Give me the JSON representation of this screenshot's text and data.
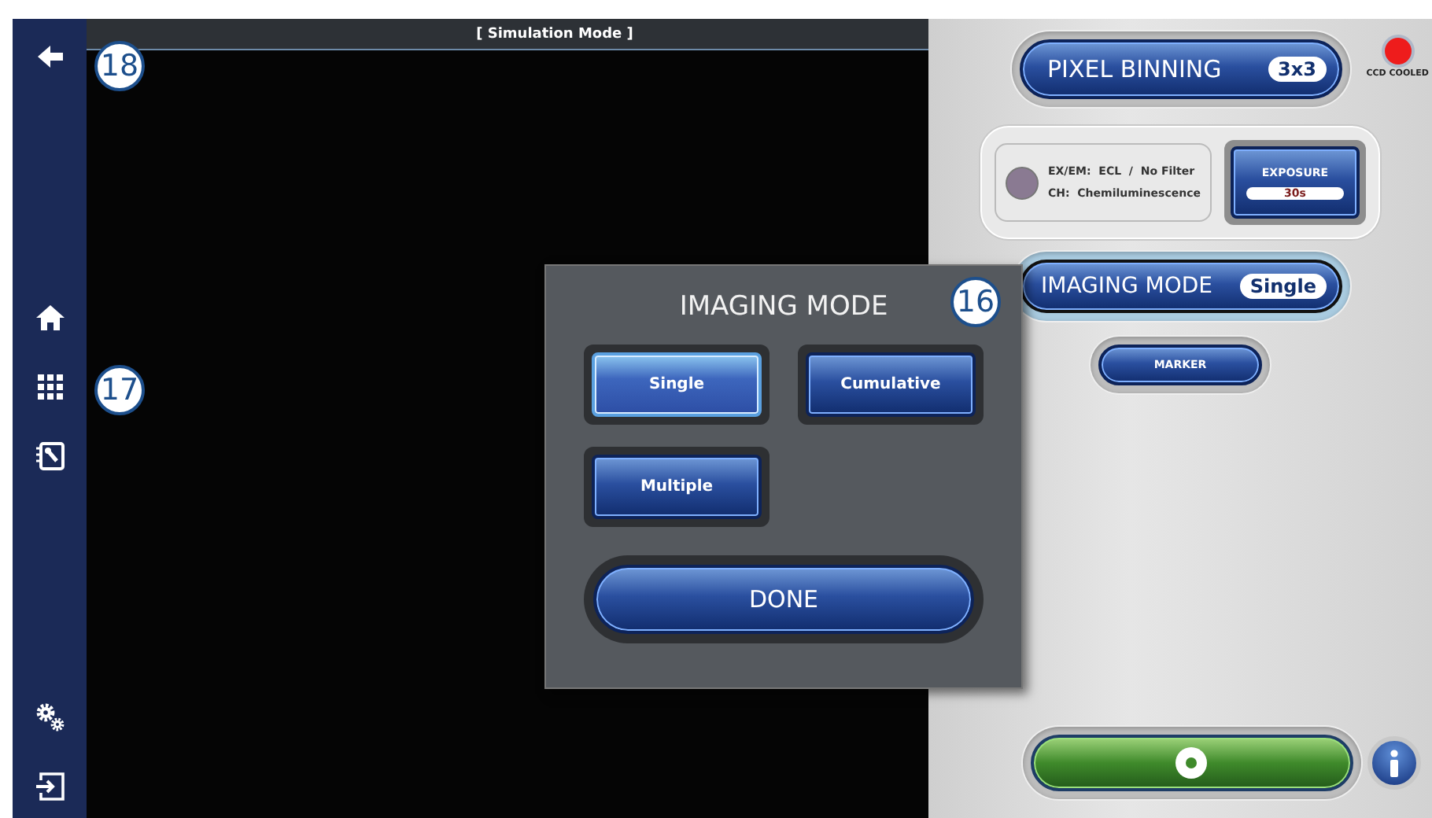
{
  "viewer": {
    "title": "[ Simulation Mode ]"
  },
  "callouts": [
    "18",
    "17",
    "16"
  ],
  "panel": {
    "pixel_binning": {
      "label": "PIXEL BINNING",
      "value": "3x3"
    },
    "ccd": {
      "label": "CCD COOLED",
      "color": "#ee1c1c"
    },
    "filter": {
      "color": "#8a7a92",
      "exem_label": "EX/EM:",
      "exem_value": "ECL  /  No Filter",
      "ch_label": "CH:",
      "ch_value": "Chemiluminescence"
    },
    "exposure": {
      "label": "EXPOSURE",
      "value": "30s"
    },
    "imaging_mode": {
      "label": "IMAGING MODE",
      "value": "Single"
    },
    "marker": {
      "label": "MARKER"
    }
  },
  "dialog": {
    "title": "IMAGING MODE",
    "options": [
      {
        "label": "Single",
        "selected": true
      },
      {
        "label": "Cumulative",
        "selected": false
      },
      {
        "label": "Multiple",
        "selected": false
      }
    ],
    "done": "DONE"
  }
}
